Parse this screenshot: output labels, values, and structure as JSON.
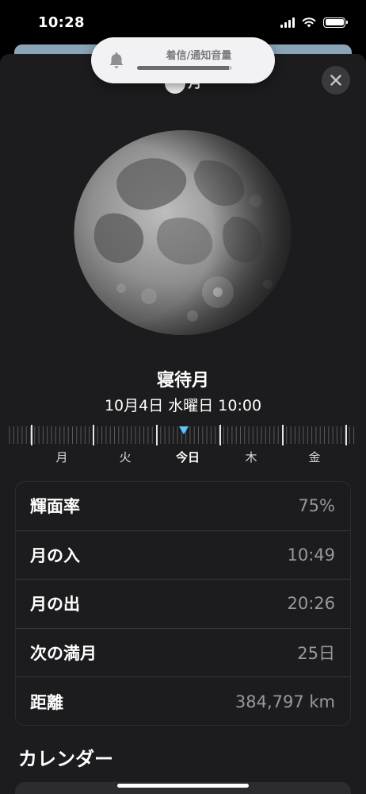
{
  "status_bar": {
    "time": "10:28",
    "signal_bars": 4,
    "battery_level": 1.0
  },
  "hud": {
    "label": "着信/通知音量",
    "volume_level": 0.97,
    "icon": "bell-icon"
  },
  "header": {
    "title_peek": "月",
    "close_icon": "close-icon"
  },
  "moon": {
    "phase_name": "寝待月",
    "datetime": "10月4日 水曜日 10:00"
  },
  "timeline": {
    "days": [
      {
        "label": "月",
        "today": false
      },
      {
        "label": "火",
        "today": false
      },
      {
        "label": "今日",
        "today": true
      },
      {
        "label": "木",
        "today": false
      },
      {
        "label": "金",
        "today": false
      }
    ],
    "accent": "#5ac8fa"
  },
  "info": {
    "rows": [
      {
        "label": "輝面率",
        "value": "75%"
      },
      {
        "label": "月の入",
        "value": "10:49"
      },
      {
        "label": "月の出",
        "value": "20:26"
      },
      {
        "label": "次の満月",
        "value": "25日"
      },
      {
        "label": "距離",
        "value": "384,797 km"
      }
    ]
  },
  "calendar": {
    "title": "カレンダー"
  }
}
